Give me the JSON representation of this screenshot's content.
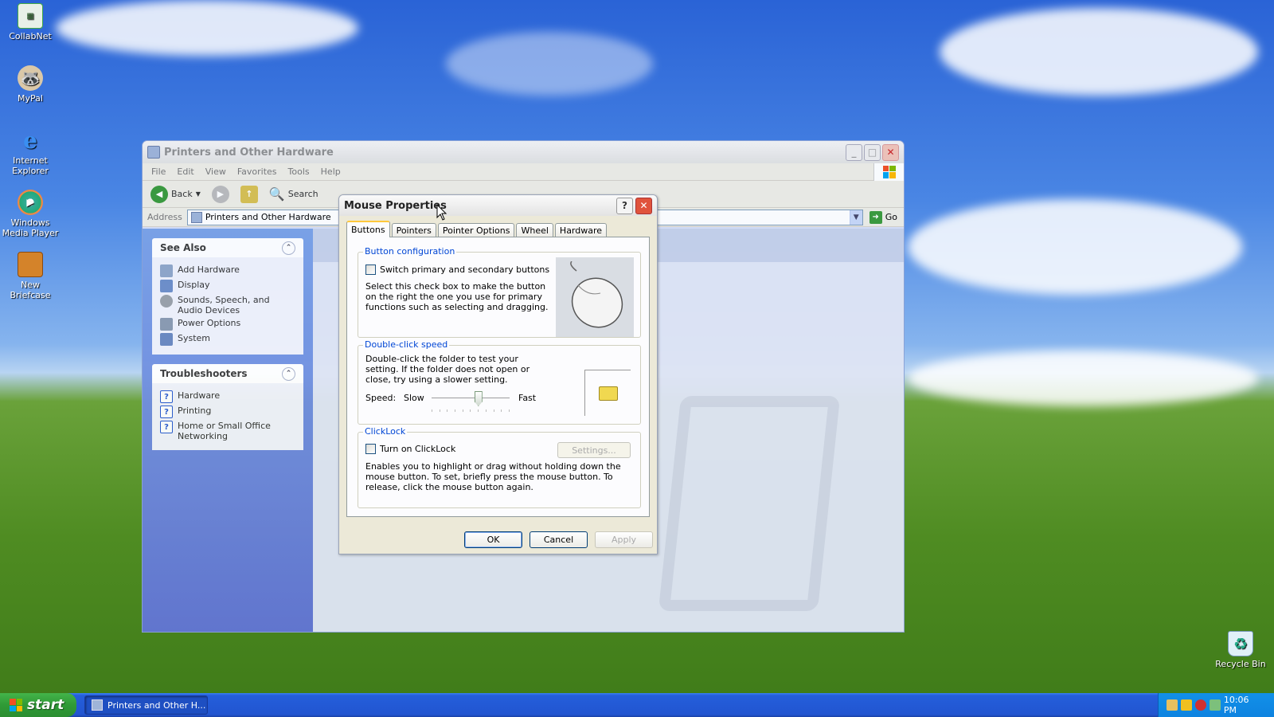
{
  "desktop": {
    "icons": [
      {
        "label": "CollabNet",
        "icon": "collabnet-icon"
      },
      {
        "label": "MyPal",
        "icon": "mypal-icon"
      },
      {
        "label": "Internet Explorer",
        "icon": "internet-explorer-icon"
      },
      {
        "label": "Windows Media Player",
        "icon": "media-player-icon"
      },
      {
        "label": "New Briefcase",
        "icon": "briefcase-icon"
      },
      {
        "label": "Recycle Bin",
        "icon": "recycle-bin-icon"
      }
    ]
  },
  "explorer": {
    "title": "Printers and Other Hardware",
    "menu": [
      "File",
      "Edit",
      "View",
      "Favorites",
      "Tools",
      "Help"
    ],
    "toolbar": {
      "back_label": "Back",
      "search_label": "Search"
    },
    "address": {
      "label": "Address",
      "value": "Printers and Other Hardware",
      "go_label": "Go"
    },
    "see_also": {
      "title": "See Also",
      "items": [
        "Add Hardware",
        "Display",
        "Sounds, Speech, and Audio Devices",
        "Power Options",
        "System"
      ]
    },
    "troubleshooters": {
      "title": "Troubleshooters",
      "items": [
        "Hardware",
        "Printing",
        "Home or Small Office Networking"
      ]
    }
  },
  "dialog": {
    "title": "Mouse Properties",
    "tabs": [
      "Buttons",
      "Pointers",
      "Pointer Options",
      "Wheel",
      "Hardware"
    ],
    "active_tab": "Buttons",
    "button_config": {
      "title": "Button configuration",
      "checkbox_label": "Switch primary and secondary buttons",
      "checked": false,
      "description": "Select this check box to make the button on the right the one you use for primary functions such as selecting and dragging."
    },
    "double_click": {
      "title": "Double-click speed",
      "description": "Double-click the folder to test your setting. If the folder does not open or close, try using a slower setting.",
      "speed_label": "Speed:",
      "slow_label": "Slow",
      "fast_label": "Fast",
      "speed_fraction": 0.6
    },
    "clicklock": {
      "title": "ClickLock",
      "checkbox_label": "Turn on ClickLock",
      "checked": false,
      "settings_label": "Settings...",
      "description": "Enables you to highlight or drag without holding down the mouse button. To set, briefly press the mouse button. To release, click the mouse button again."
    },
    "buttons": {
      "ok": "OK",
      "cancel": "Cancel",
      "apply": "Apply"
    }
  },
  "taskbar": {
    "start_label": "start",
    "task_item": "Printers and Other H...",
    "clock": "10:06 PM"
  }
}
